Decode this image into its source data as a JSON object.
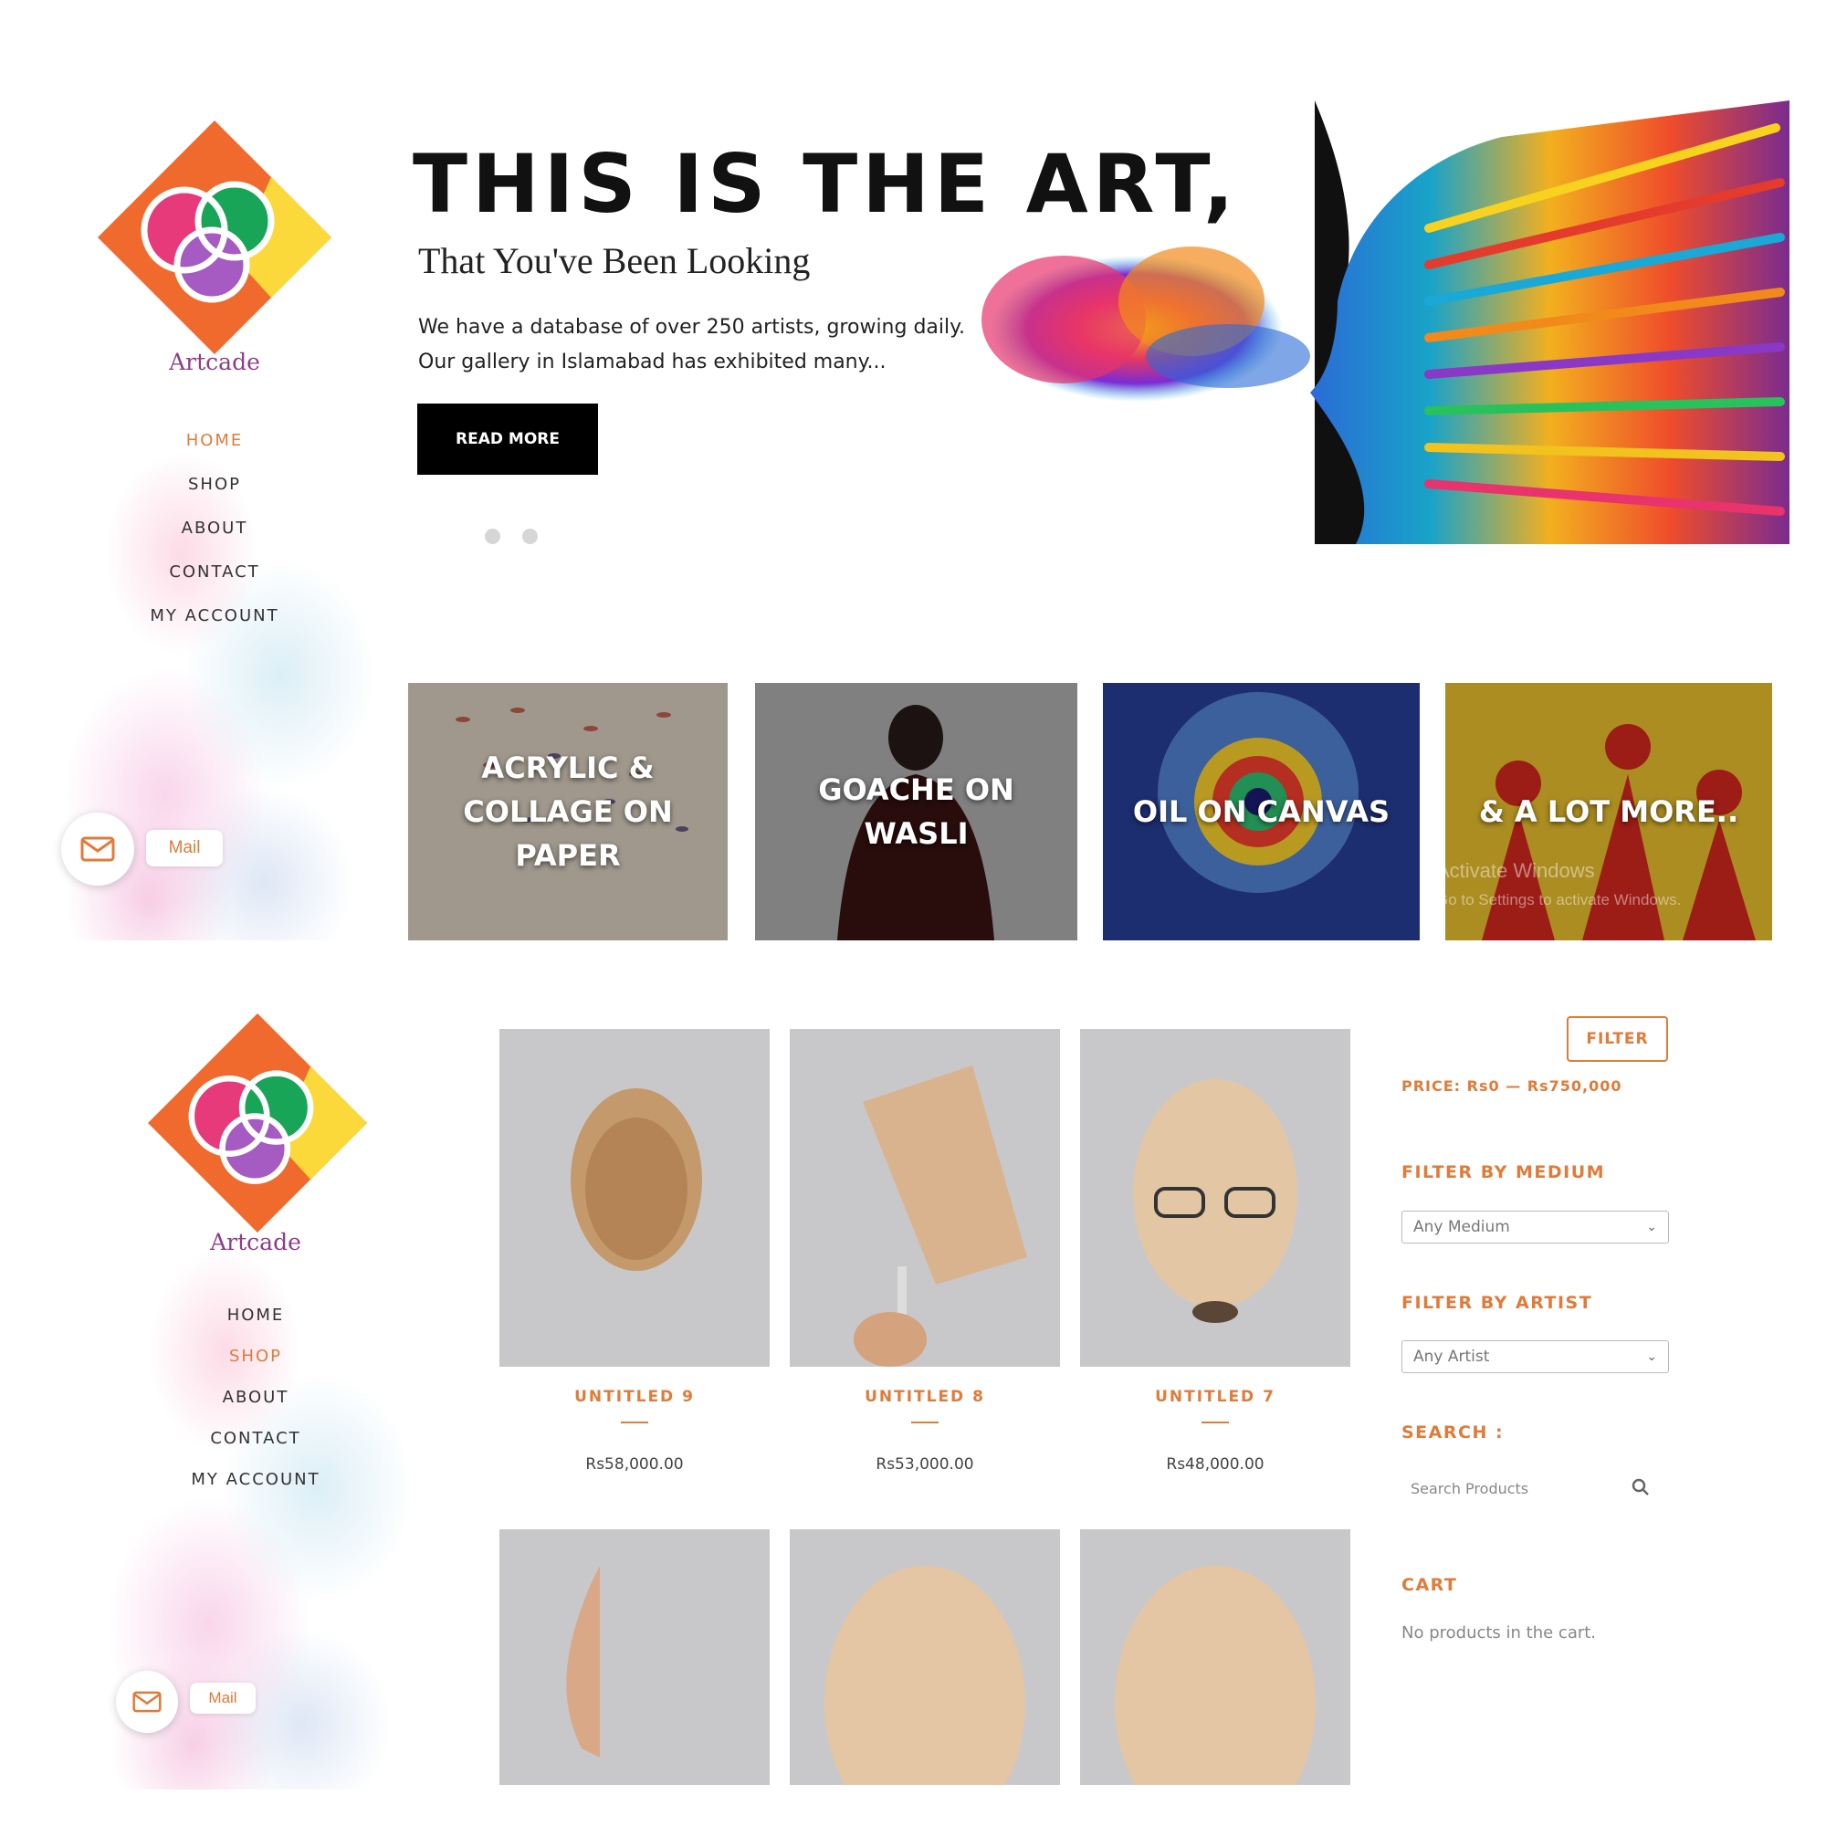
{
  "brand": {
    "name": "Artcade"
  },
  "nav": {
    "items": [
      "HOME",
      "SHOP",
      "ABOUT",
      "CONTACT",
      "MY ACCOUNT"
    ],
    "active_top": "HOME",
    "active_bottom": "SHOP"
  },
  "mail": {
    "label": "Mail",
    "icon": "envelope-icon"
  },
  "hero": {
    "title": "THIS IS THE ART,",
    "subtitle": "That You've Been Looking",
    "text_line1": "We have a database of over 250 artists, growing daily.",
    "text_line2": "Our gallery in Islamabad has exhibited many...",
    "cta": "READ MORE",
    "slides_count": 2
  },
  "categories": [
    {
      "label": "ACRYLIC & COLLAGE ON PAPER"
    },
    {
      "label": "GOACHE ON WASLI"
    },
    {
      "label": "OIL ON CANVAS"
    },
    {
      "label": "& A LOT MORE.."
    }
  ],
  "watermark": {
    "line1": "Activate Windows",
    "line2": "Go to Settings to activate Windows."
  },
  "products": [
    {
      "name": "UNTITLED 9",
      "price": "Rs58,000.00"
    },
    {
      "name": "UNTITLED 8",
      "price": "Rs53,000.00"
    },
    {
      "name": "UNTITLED 7",
      "price": "Rs48,000.00"
    }
  ],
  "shop": {
    "filter_button": "FILTER",
    "price_range": "PRICE: Rs0 — Rs750,000",
    "filter_medium_title": "FILTER BY MEDIUM",
    "filter_medium_value": "Any Medium",
    "filter_artist_title": "FILTER BY ARTIST",
    "filter_artist_value": "Any Artist",
    "search_title": "SEARCH :",
    "search_placeholder": "Search Products",
    "cart_title": "CART",
    "cart_empty": "No products in the cart."
  },
  "colors": {
    "accent": "#e07b39",
    "brand_purple": "#8e3d88",
    "button_dark": "#000000"
  }
}
